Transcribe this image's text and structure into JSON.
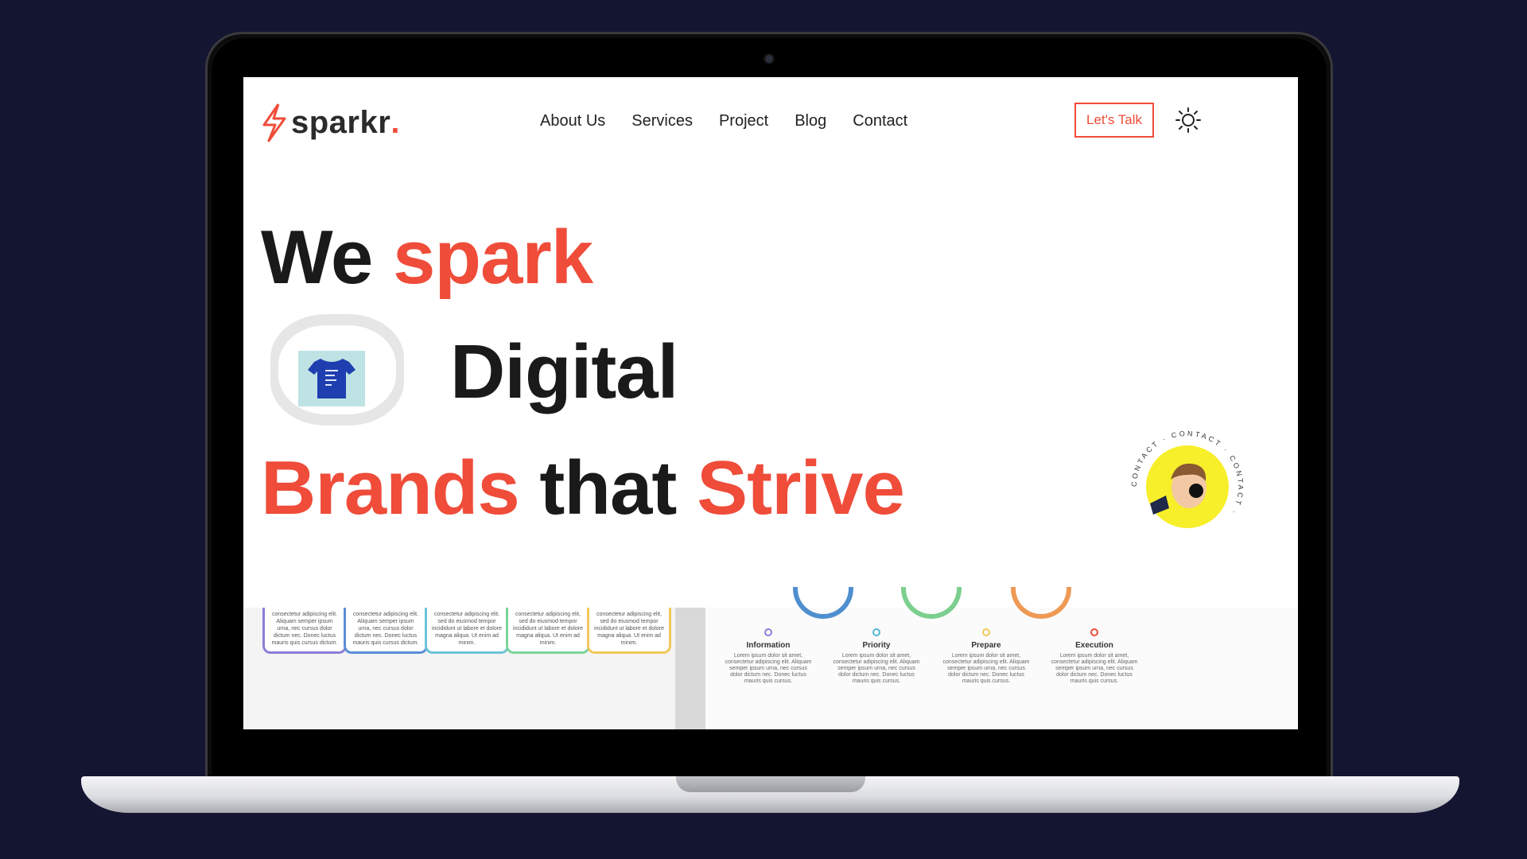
{
  "logo": {
    "name": "sparkr",
    "dot": "."
  },
  "nav": [
    "About Us",
    "Services",
    "Project",
    "Blog",
    "Contact"
  ],
  "cta_label": "Let's Talk",
  "hero": {
    "line1": [
      "We",
      "spark"
    ],
    "line2": "Digital",
    "line3": [
      "Brands",
      "that",
      "Strive"
    ]
  },
  "badge_text": "CONTACT · CONTACT · CONTACT ·",
  "colors": {
    "accent": "#ef4c3a",
    "background": "#141531"
  },
  "cards": [
    "consectetur adipiscing elit. Aliquam semper ipsum urna, nec cursus dolor dictum nec. Donec luctus mauris quis cursus dictum.",
    "consectetur adipiscing elit. Aliquam semper ipsum urna, nec cursus dolor dictum nec. Donec luctus mauris quis cursus dictum.",
    "consectetur adipiscing elit, sed do eiusmod tempor incididunt ut labore et dolore magna aliqua. Ut enim ad minim.",
    "consectetur adipiscing elit, sed do eiusmod tempor incididunt ut labore et dolore magna aliqua. Ut enim ad minim.",
    "consectetur adipiscing elit, sed do eiusmod tempor incididunt ut labore et dolore magna aliqua. Ut enim ad minim."
  ],
  "steps": [
    {
      "title": "Information",
      "body": "Lorem ipsum dolor sit amet, consectetur adipiscing elit. Aliquam semper ipsum urna, nec cursus dolor dictum nec. Donec luctus mauris quis cursus."
    },
    {
      "title": "Priority",
      "body": "Lorem ipsum dolor sit amet, consectetur adipiscing elit. Aliquam semper ipsum urna, nec cursus dolor dictum nec. Donec luctus mauris quis cursus."
    },
    {
      "title": "Prepare",
      "body": "Lorem ipsum dolor sit amet, consectetur adipiscing elit. Aliquam semper ipsum urna, nec cursus dolor dictum nec. Donec luctus mauris quis cursus."
    },
    {
      "title": "Execution",
      "body": "Lorem ipsum dolor sit amet, consectetur adipiscing elit. Aliquam semper ipsum urna, nec cursus dolor dictum nec. Donec luctus mauris quis cursus."
    }
  ]
}
